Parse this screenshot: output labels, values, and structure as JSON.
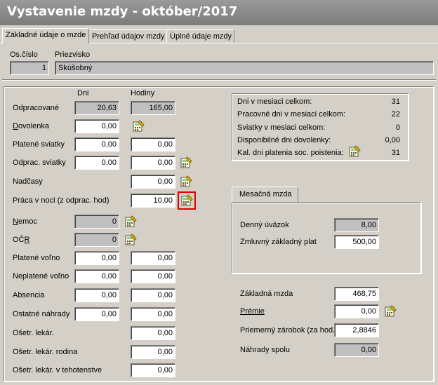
{
  "title": "Vystavenie mzdy -  október/2017",
  "tabs": [
    "Základné údaje o mzde",
    "Prehľad údajov mzdy",
    "Úplné údaje mzdy"
  ],
  "employee": {
    "id_label": "Os.číslo",
    "name_label": "Priezvisko",
    "id": "1",
    "name": "Skúšobný"
  },
  "columns": {
    "days": "Dni",
    "hours": "Hodiny"
  },
  "rows": {
    "odpracovane": {
      "label": "Odpracované",
      "days": "20,63",
      "hours": "165,00"
    },
    "dovolenka": {
      "label_u": "D",
      "label_rest": "ovolenka",
      "days": "0,00"
    },
    "platene_sviatky": {
      "label": "Platené sviatky",
      "days": "0,00",
      "hours": "0,00"
    },
    "odprac_sviatky": {
      "label": "Odprac. sviatky",
      "days": "0,00",
      "hours": "0,00"
    },
    "nadcasy": {
      "label": "Nadčasy",
      "hours": "0,00"
    },
    "praca_v_noci": {
      "label": "Práca v noci (z odprac. hod)",
      "hours": "10,00"
    },
    "nemoc": {
      "label_u": "N",
      "label_rest": "emoc",
      "days": "0"
    },
    "ocr": {
      "label_pre": "OČ",
      "label_u": "R",
      "days": "0"
    },
    "platene_volno": {
      "label": "Platené voľno",
      "days": "0,00",
      "hours": "0,00"
    },
    "neplatene_volno": {
      "label": "Neplatené voľno",
      "days": "0,00",
      "hours": "0,00"
    },
    "absencia": {
      "label": "Absencia",
      "days": "0,00",
      "hours": "0,00"
    },
    "ostatne_nahrady": {
      "label": "Ostatné náhrady",
      "days": "0,00",
      "hours": "0,00"
    },
    "oset_lekar": {
      "label": "Ošetr. lekár.",
      "hours": "0,00"
    },
    "oset_lekar_rodina": {
      "label": "Ošetr. lekár. rodina",
      "hours": "0,00"
    },
    "oset_lekar_tehot": {
      "label": "Ošetr. lekár. v tehotenstve",
      "hours": "0,00"
    }
  },
  "summary": [
    {
      "label": "Dni v mesiaci celkom:",
      "value": "31"
    },
    {
      "label": "Pracovné dni v mesiaci celkom:",
      "value": "22"
    },
    {
      "label": "Sviatky v mesiaci celkom:",
      "value": "0"
    },
    {
      "label": "Disponibilné dni dovolenky:",
      "value": "0,00"
    },
    {
      "label": "Kal. dni platenia soc. poistenia:",
      "value": "31"
    }
  ],
  "monthly": {
    "tab": "Mesačná mzda",
    "denny_label": "Denný úväzok",
    "denny": "8,00",
    "zmluvny_label": "Zmluvný základný plat",
    "zmluvny": "500,00"
  },
  "totals": {
    "zakladna_label": "Základná mzda",
    "zakladna": "468,75",
    "premie_label": "Prémie",
    "premie": "0,00",
    "priemerny_label": "Priemerný zárobok (za hod.)",
    "priemerny": "2,8846",
    "nahrady_label": "Náhrady spolu",
    "nahrady": "0,00"
  },
  "icon_name": "calculator-icon"
}
